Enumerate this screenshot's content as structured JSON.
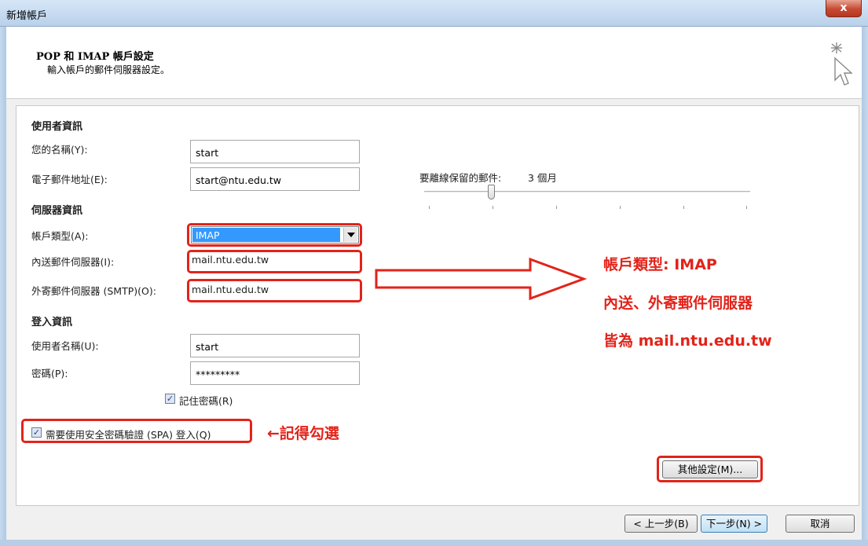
{
  "window": {
    "title": "新增帳戶",
    "close_glyph": "x"
  },
  "header": {
    "title": "POP 和 IMAP 帳戶設定",
    "subtitle": "輸入帳戶的郵件伺服器設定。",
    "icon": "cursor-sparkle-icon"
  },
  "user_info": {
    "section": "使用者資訊",
    "name_label": "您的名稱(Y):",
    "name_value": "start",
    "email_label": "電子郵件地址(E):",
    "email_value": "start@ntu.edu.tw"
  },
  "server_info": {
    "section": "伺服器資訊",
    "account_type_label": "帳戶類型(A):",
    "account_type_value": "IMAP",
    "incoming_label": "內送郵件伺服器(I):",
    "incoming_value": "mail.ntu.edu.tw",
    "outgoing_label": "外寄郵件伺服器 (SMTP)(O):",
    "outgoing_value": "mail.ntu.edu.tw"
  },
  "login_info": {
    "section": "登入資訊",
    "username_label": "使用者名稱(U):",
    "username_value": "start",
    "password_label": "密碼(P):",
    "password_value": "*********",
    "remember_label": "記住密碼(R)",
    "remember_checked": true,
    "spa_label": "需要使用安全密碼驗證 (SPA) 登入(Q)",
    "spa_checked": true
  },
  "offline": {
    "label": "要離線保留的郵件:",
    "value": "3 個月",
    "slider_fraction": 0.2
  },
  "annotations": {
    "line1": "帳戶類型: IMAP",
    "line2": "內送、外寄郵件伺服器",
    "line3": "皆為 mail.ntu.edu.tw",
    "spa_note": "←記得勾選",
    "color": "#e2231a"
  },
  "buttons": {
    "more_settings": "其他設定(M)...",
    "back": "< 上一步(B)",
    "next": "下一步(N) >",
    "cancel": "取消"
  }
}
